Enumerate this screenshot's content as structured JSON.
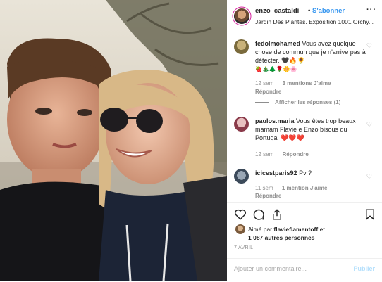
{
  "post": {
    "username": "enzo_castaldi__",
    "separator": "•",
    "follow_label": "S'abonner",
    "more_label": "···",
    "location": "Jardin Des Plantes. Exposition 1001 Orchy..."
  },
  "comments": [
    {
      "user": "fedolmohamed",
      "text": "Vous avez quelque chose de commun que je n'arrive pas à détecter.",
      "emoji": "🖤🔥🌻",
      "emoji2": "🍓🎄🌲🌹🌼🌸",
      "time": "12 sem",
      "likes": "3 mentions J'aime",
      "reply": "Répondre",
      "view_replies": "Afficher les réponses (1)"
    },
    {
      "user": "paulos.maria",
      "text": "Vous êtes trop beaux mamam Flavie e Enzo bisous du Portugal",
      "emoji": "❤️❤️❤️",
      "time": "12 sem",
      "reply": "Répondre"
    },
    {
      "user": "icicestparis92",
      "text": "Pv ?",
      "time": "11 sem",
      "likes": "1 mention J'aime",
      "reply": "Répondre"
    }
  ],
  "liked_by": {
    "prefix": "Aimé par",
    "user": "flavieflamentoff",
    "connector": "et",
    "others": "1 087 autres personnes"
  },
  "date": "7 AVRIL",
  "add_comment": {
    "placeholder": "Ajouter un commentaire...",
    "publish_label": "Publier"
  },
  "icons": {
    "like": "heart-icon",
    "comment": "comment-bubble-icon",
    "share": "share-icon",
    "save": "bookmark-icon"
  },
  "colors": {
    "link_blue": "#3897f0",
    "publish_disabled": "#b2dffc",
    "muted": "#8e8e8e"
  }
}
